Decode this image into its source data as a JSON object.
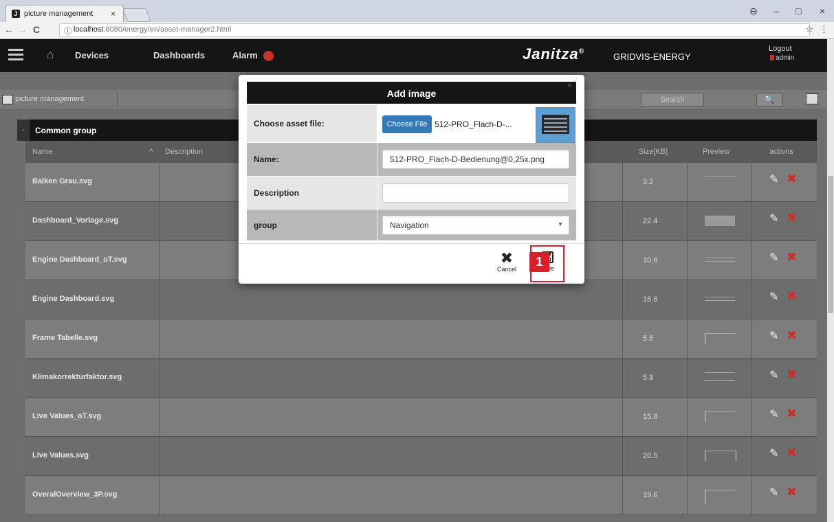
{
  "browser": {
    "tab_title": "picture management",
    "tab_close": "×",
    "url_host": "localhost",
    "url_path": ":8080/energy/en/asset-manager2.html",
    "back": "←",
    "forward": "→",
    "reload": "C",
    "bookmark_icon": "☆",
    "menu_icon": "⋮",
    "minimize": "–",
    "maximize": "□",
    "close": "×",
    "profile_icon": "⊖"
  },
  "header": {
    "home_icon": "⌂",
    "nav": [
      "Devices",
      "Dashboards",
      "Alarm"
    ],
    "brand": "Janitza",
    "brand_mark": "®",
    "product": "GRIDVIS-ENERGY",
    "logout": "Logout",
    "user": "admin"
  },
  "subbar": {
    "title": "picture management",
    "search_placeholder": "Search",
    "search_button": "🔍"
  },
  "group": {
    "toggle": "-",
    "title": "Common group",
    "columns": {
      "name": "Name",
      "sort_icon": "^",
      "description": "Description",
      "size": "Size[KB]",
      "preview": "Preview",
      "actions": "actions"
    },
    "rows": [
      {
        "name": "Balken Grau.svg",
        "size": "3.2"
      },
      {
        "name": "Dashboard_Vorlage.svg",
        "size": "22.4"
      },
      {
        "name": "Engine Dashboard_oT.svg",
        "size": "10.8"
      },
      {
        "name": "Engine Dashboard.svg",
        "size": "16.8"
      },
      {
        "name": "Frame Tabelle.svg",
        "size": "5.5"
      },
      {
        "name": "Klimakorrekturfaktor.svg",
        "size": "5.9"
      },
      {
        "name": "Live Values_oT.svg",
        "size": "15.8"
      },
      {
        "name": "Live Values.svg",
        "size": "20.5"
      },
      {
        "name": "OveralOverview_3P.svg",
        "size": "19.6"
      }
    ],
    "edit_icon": "✎",
    "delete_icon": "✖"
  },
  "modal": {
    "title": "Add image",
    "close": "×",
    "fields": {
      "file_label": "Choose asset file:",
      "choose_button": "Choose File",
      "file_name": "512-PRO_Flach-D-...",
      "name_label": "Name:",
      "name_value": "512-PRO_Flach-D-Bedienung@0,25x.png",
      "description_label": "Description",
      "description_value": "",
      "group_label": "group",
      "group_value": "Navigation",
      "group_caret": "▼"
    },
    "cancel_icon": "✖",
    "cancel_label": "Cancel",
    "save_label": "Save"
  },
  "annotation": {
    "step": "1"
  },
  "colors": {
    "accent_blue": "#337ab7",
    "highlight_red": "#d9202a",
    "header_bg": "#151515"
  }
}
